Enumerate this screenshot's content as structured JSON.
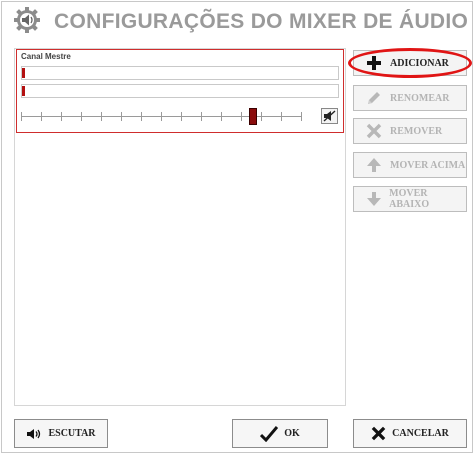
{
  "window": {
    "title": "CONFIGURAÇÕES DO MIXER DE ÁUDIO",
    "title_icon": "gear-speaker-icon"
  },
  "channel": {
    "label": "Canal Mestre",
    "meter_left_level": 0.01,
    "meter_right_level": 0.01,
    "volume_level": 0.83,
    "muted": true,
    "mute_icon": "muted-speaker-icon"
  },
  "side_buttons": [
    {
      "label": "ADICIONAR",
      "icon": "plus-icon",
      "enabled": true,
      "highlighted": true
    },
    {
      "label": "RENOMEAR",
      "icon": "pencil-icon",
      "enabled": false
    },
    {
      "label": "REMOVER",
      "icon": "x-icon",
      "enabled": false
    },
    {
      "label": "MOVER ACIMA",
      "icon": "arrow-up-icon",
      "enabled": false
    },
    {
      "label": "MOVER ABAIXO",
      "icon": "arrow-down-icon",
      "enabled": false
    }
  ],
  "footer": {
    "listen_label": "ESCUTAR",
    "ok_label": "OK",
    "cancel_label": "CANCELAR"
  },
  "colors": {
    "highlight": "#e01515",
    "meter": "#b31010",
    "slider_thumb": "#8a0c0c",
    "title": "#9a9a9a"
  }
}
